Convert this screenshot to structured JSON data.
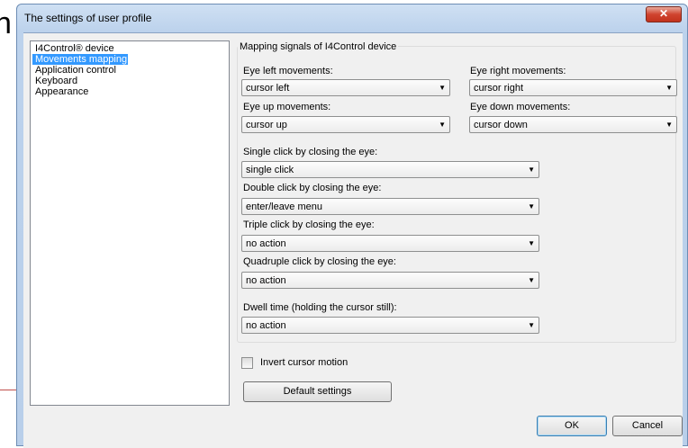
{
  "window": {
    "title": "The settings of user profile",
    "close_glyph": "✕"
  },
  "nav": {
    "items": [
      {
        "label": "I4Control® device",
        "selected": false
      },
      {
        "label": "Movements mapping",
        "selected": true
      },
      {
        "label": "Application control",
        "selected": false
      },
      {
        "label": "Keyboard",
        "selected": false
      },
      {
        "label": "Appearance",
        "selected": false
      }
    ]
  },
  "mapping": {
    "group_title": "Mapping signals of I4Control device",
    "eye_left": {
      "label": "Eye left movements:",
      "value": "cursor left"
    },
    "eye_right": {
      "label": "Eye right movements:",
      "value": "cursor right"
    },
    "eye_up": {
      "label": "Eye up movements:",
      "value": "cursor up"
    },
    "eye_down": {
      "label": "Eye down movements:",
      "value": "cursor down"
    },
    "single_click": {
      "label": "Single click by closing the eye:",
      "value": "single click"
    },
    "double_click": {
      "label": "Double click by closing the eye:",
      "value": "enter/leave menu"
    },
    "triple_click": {
      "label": "Triple click by closing the eye:",
      "value": "no action"
    },
    "quadruple_click": {
      "label": "Quadruple click by closing the eye:",
      "value": "no action"
    },
    "dwell_time": {
      "label": "Dwell time (holding the cursor still):",
      "value": "no action"
    }
  },
  "invert": {
    "label": "Invert cursor motion",
    "checked": false
  },
  "buttons": {
    "default_settings": "Default settings",
    "ok": "OK",
    "cancel": "Cancel"
  },
  "icons": {
    "dropdown_arrow": "▼"
  },
  "colors": {
    "selection": "#3399ff",
    "close_button": "#d0442f"
  }
}
